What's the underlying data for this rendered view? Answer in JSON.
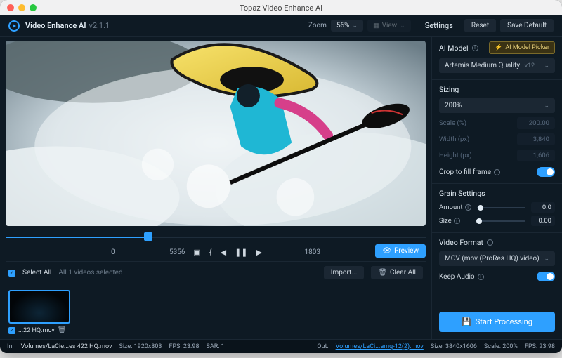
{
  "window": {
    "title": "Topaz Video Enhance AI"
  },
  "header": {
    "app_name": "Video Enhance AI",
    "version": "v2.1.1",
    "zoom_label": "Zoom",
    "zoom_value": "56%",
    "view_label": "View",
    "settings_label": "Settings",
    "reset_label": "Reset",
    "save_default_label": "Save Default"
  },
  "transport": {
    "frame_a": "0",
    "frame_current": "5356",
    "frame_b": "1803",
    "preview_label": "Preview"
  },
  "queue": {
    "select_all_label": "Select All",
    "selected_text": "All 1 videos selected",
    "import_label": "Import...",
    "clear_all_label": "Clear All",
    "thumb_name": "...22 HQ.mov"
  },
  "panel": {
    "ai_model": {
      "title": "AI Model",
      "picker_label": "AI Model Picker",
      "selected": "Artemis Medium Quality",
      "selected_version": "v12"
    },
    "sizing": {
      "title": "Sizing",
      "preset": "200%",
      "scale_label": "Scale (%)",
      "scale_value": "200.00",
      "width_label": "Width (px)",
      "width_value": "3,840",
      "height_label": "Height (px)",
      "height_value": "1,606",
      "crop_label": "Crop to fill frame"
    },
    "grain": {
      "title": "Grain Settings",
      "amount_label": "Amount",
      "amount_value": "0.0",
      "size_label": "Size",
      "size_value": "0.00"
    },
    "format": {
      "title": "Video Format",
      "codec": "MOV (mov (ProRes HQ) video)",
      "keep_audio_label": "Keep Audio"
    },
    "start_label": "Start Processing"
  },
  "footer": {
    "in_label": "In:",
    "in_path": "Volumes/LaCie...es 422 HQ.mov",
    "in_size": "Size: 1920x803",
    "in_fps": "FPS: 23.98",
    "in_sar": "SAR: 1",
    "out_label": "Out:",
    "out_path": "Volumes/LaCi...amq-12(2).mov",
    "out_size": "Size: 3840x1606",
    "out_scale": "Scale: 200%",
    "out_fps": "FPS: 23.98"
  }
}
